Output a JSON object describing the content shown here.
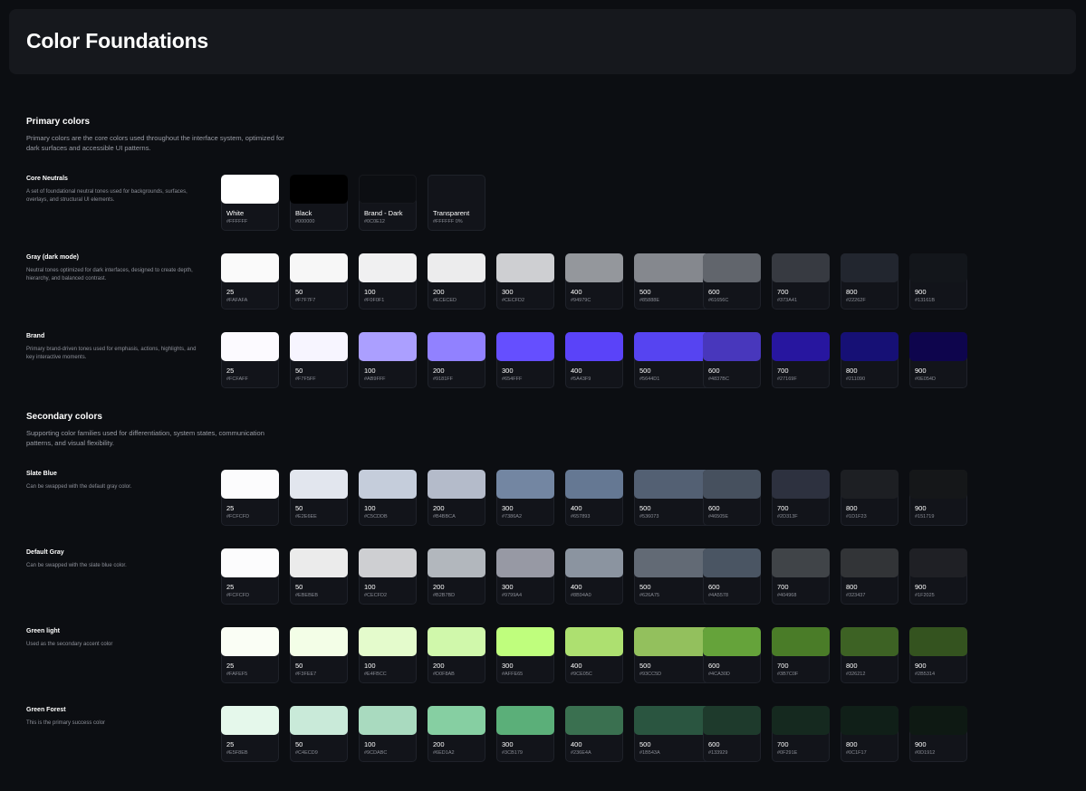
{
  "page_title": "Color Foundations",
  "sections": [
    {
      "title": "Primary colors",
      "description": "Primary colors are the core colors used throughout the interface system, optimized for dark surfaces and accessible UI patterns.",
      "groups": [
        {
          "name": "Core Neutrals",
          "description": "A set of foundational neutral tones used for backgrounds, surfaces, overlays, and structural UI elements.",
          "swatches": [
            {
              "label": "White",
              "hex": "#FFFFFF",
              "color": "#FFFFFF"
            },
            {
              "label": "Black",
              "hex": "#000000",
              "color": "#000000"
            },
            {
              "label": "Brand - Dark",
              "hex": "#0C0E12",
              "color": "#0C0E12"
            },
            {
              "label": "Transparent",
              "hex": "#FFFFFF 0%",
              "color": "transparent"
            }
          ]
        },
        {
          "name": "Gray (dark mode)",
          "description": "Neutral tones optimized for dark interfaces, designed to create depth, hierarchy, and balanced contrast.",
          "swatches": [
            {
              "label": "25",
              "hex": "#FAFAFA",
              "color": "#FAFAFA"
            },
            {
              "label": "50",
              "hex": "#F7F7F7",
              "color": "#F7F7F7"
            },
            {
              "label": "100",
              "hex": "#F0F0F1",
              "color": "#F0F0F1"
            },
            {
              "label": "200",
              "hex": "#ECECED",
              "color": "#ECECED"
            },
            {
              "label": "300",
              "hex": "#CECFD2",
              "color": "#CECFD2"
            },
            {
              "label": "400",
              "hex": "#94979C",
              "color": "#94979C"
            },
            {
              "label": "500",
              "hex": "#85888E",
              "color": "#85888E"
            },
            {
              "label": "600",
              "hex": "#61656C",
              "color": "#61656C"
            },
            {
              "label": "700",
              "hex": "#373A41",
              "color": "#373A41"
            },
            {
              "label": "800",
              "hex": "#22262F",
              "color": "#22262F"
            },
            {
              "label": "900",
              "hex": "#13161B",
              "color": "#13161B"
            }
          ]
        },
        {
          "name": "Brand",
          "description": "Primary brand-driven tones used for emphasis, actions, highlights, and key interactive moments.",
          "swatches": [
            {
              "label": "25",
              "hex": "#FCFAFF",
              "color": "#FCFAFF"
            },
            {
              "label": "50",
              "hex": "#F7F5FF",
              "color": "#F7F5FF"
            },
            {
              "label": "100",
              "hex": "#AB9FFF",
              "color": "#AB9FFF"
            },
            {
              "label": "200",
              "hex": "#9181FF",
              "color": "#9181FF"
            },
            {
              "label": "300",
              "hex": "#654FFF",
              "color": "#654FFF"
            },
            {
              "label": "400",
              "hex": "#5A43F9",
              "color": "#5A43F9"
            },
            {
              "label": "500",
              "hex": "#5644D1",
              "color": "#5644F1"
            },
            {
              "label": "600",
              "hex": "#4837BC",
              "color": "#4837BC"
            },
            {
              "label": "700",
              "hex": "#27169F",
              "color": "#27169F"
            },
            {
              "label": "800",
              "hex": "#211090",
              "color": "#161075"
            },
            {
              "label": "900",
              "hex": "#0E054D",
              "color": "#0E054D"
            }
          ]
        }
      ]
    },
    {
      "title": "Secondary colors",
      "description": "Supporting color families used for differentiation, system states, communication patterns, and visual flexibility.",
      "groups": [
        {
          "name": "Slate Blue",
          "description": "Can be swapped with the default gray color.",
          "swatches": [
            {
              "label": "25",
              "hex": "#FCFCFD",
              "color": "#FCFCFD"
            },
            {
              "label": "50",
              "hex": "#E2E6EE",
              "color": "#E2E6EE"
            },
            {
              "label": "100",
              "hex": "#C5CDDB",
              "color": "#C5CDDB"
            },
            {
              "label": "200",
              "hex": "#B4BBCA",
              "color": "#B4BBCA"
            },
            {
              "label": "300",
              "hex": "#7386A2",
              "color": "#7386A2"
            },
            {
              "label": "400",
              "hex": "#657893",
              "color": "#657893"
            },
            {
              "label": "500",
              "hex": "#536073",
              "color": "#536073"
            },
            {
              "label": "600",
              "hex": "#46505E",
              "color": "#46505E"
            },
            {
              "label": "700",
              "hex": "#2D313F",
              "color": "#2D313F"
            },
            {
              "label": "800",
              "hex": "#1D1F23",
              "color": "#1D1F23"
            },
            {
              "label": "900",
              "hex": "#151719",
              "color": "#151719"
            }
          ]
        },
        {
          "name": "Default Gray",
          "description": "Can be swapped with the slate blue color.",
          "swatches": [
            {
              "label": "25",
              "hex": "#FCFCFD",
              "color": "#FCFCFD"
            },
            {
              "label": "50",
              "hex": "#EBEBEB",
              "color": "#EBEBEB"
            },
            {
              "label": "100",
              "hex": "#CECFD2",
              "color": "#CECFD2"
            },
            {
              "label": "200",
              "hex": "#B2B7BD",
              "color": "#B2B7BD"
            },
            {
              "label": "300",
              "hex": "#9799A4",
              "color": "#9799A4"
            },
            {
              "label": "400",
              "hex": "#8B94A0",
              "color": "#8B94A0"
            },
            {
              "label": "500",
              "hex": "#626A75",
              "color": "#626A75"
            },
            {
              "label": "600",
              "hex": "#4A5578",
              "color": "#4A5563"
            },
            {
              "label": "700",
              "hex": "#404968",
              "color": "#404448"
            },
            {
              "label": "800",
              "hex": "#323437",
              "color": "#323437"
            },
            {
              "label": "900",
              "hex": "#1F2025",
              "color": "#1F2025"
            }
          ]
        },
        {
          "name": "Green light",
          "description": "Used as the secondary accent color",
          "swatches": [
            {
              "label": "25",
              "hex": "#FAFEF5",
              "color": "#FAFEF5"
            },
            {
              "label": "50",
              "hex": "#F3FEE7",
              "color": "#F3FEE7"
            },
            {
              "label": "100",
              "hex": "#E4FBCC",
              "color": "#E4FBCC"
            },
            {
              "label": "200",
              "hex": "#D0F8AB",
              "color": "#D0F8AB"
            },
            {
              "label": "300",
              "hex": "#AFFE65",
              "color": "#BFFE7D"
            },
            {
              "label": "400",
              "hex": "#9CE05C",
              "color": "#ADE070"
            },
            {
              "label": "500",
              "hex": "#93CC5D",
              "color": "#93C05D"
            },
            {
              "label": "600",
              "hex": "#4CA30D",
              "color": "#65A33A"
            },
            {
              "label": "700",
              "hex": "#3B7C0F",
              "color": "#4A7C28"
            },
            {
              "label": "800",
              "hex": "#326212",
              "color": "#3D6224"
            },
            {
              "label": "900",
              "hex": "#2B5314",
              "color": "#34531F"
            }
          ]
        },
        {
          "name": "Green Forest",
          "description": "This is the primary success color",
          "swatches": [
            {
              "label": "25",
              "hex": "#E5F8EB",
              "color": "#E5F8EB"
            },
            {
              "label": "50",
              "hex": "#C4ECD9",
              "color": "#C9EAD9"
            },
            {
              "label": "100",
              "hex": "#9CDABC",
              "color": "#A9DABF"
            },
            {
              "label": "200",
              "hex": "#6ED1A2",
              "color": "#86CFA2"
            },
            {
              "label": "300",
              "hex": "#3CB179",
              "color": "#5BAF79"
            },
            {
              "label": "400",
              "hex": "#236E4A",
              "color": "#3A7050"
            },
            {
              "label": "500",
              "hex": "#1B543A",
              "color": "#2A5540"
            },
            {
              "label": "600",
              "hex": "#133929",
              "color": "#1E3A2C"
            },
            {
              "label": "700",
              "hex": "#0F291E",
              "color": "#15291F"
            },
            {
              "label": "800",
              "hex": "#0C1F17",
              "color": "#101F18"
            },
            {
              "label": "900",
              "hex": "#0D1912",
              "color": "#0E1913"
            }
          ]
        }
      ]
    }
  ]
}
